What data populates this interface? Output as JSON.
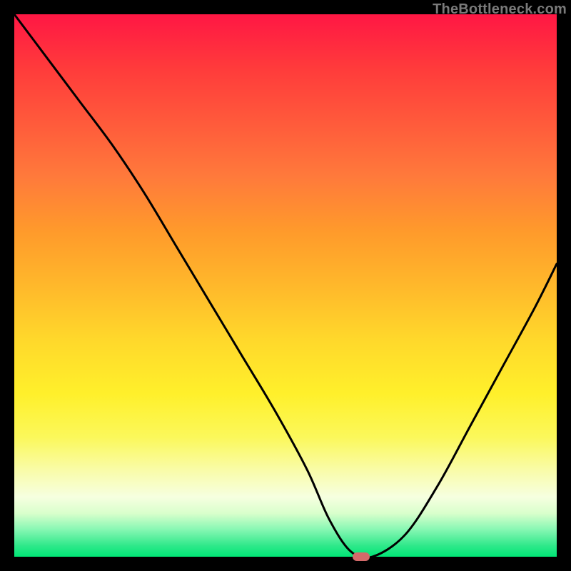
{
  "watermark": "TheBottleneck.com",
  "colors": {
    "page_background": "#000000",
    "gradient_top": "#ff1744",
    "gradient_bottom": "#00e676",
    "curve": "#000000",
    "marker": "#d46a6a"
  },
  "chart_data": {
    "type": "line",
    "title": "",
    "xlabel": "",
    "ylabel": "",
    "xlim": [
      0,
      100
    ],
    "ylim": [
      0,
      100
    ],
    "grid": false,
    "legend": false,
    "series": [
      {
        "name": "bottleneck-curve",
        "x": [
          0,
          6,
          12,
          18,
          24,
          30,
          36,
          42,
          48,
          54,
          58,
          62,
          66,
          72,
          78,
          84,
          90,
          96,
          100
        ],
        "values": [
          100,
          92,
          84,
          76,
          67,
          57,
          47,
          37,
          27,
          16,
          7,
          1,
          0,
          4,
          13,
          24,
          35,
          46,
          54
        ]
      }
    ],
    "marker": {
      "x": 64,
      "y": 0
    },
    "background_gradient": {
      "orientation": "vertical",
      "stops": [
        {
          "pos": 0.0,
          "color": "#ff1744"
        },
        {
          "pos": 0.5,
          "color": "#ffd82b"
        },
        {
          "pos": 0.9,
          "color": "#f6ffe0"
        },
        {
          "pos": 1.0,
          "color": "#00e676"
        }
      ]
    }
  }
}
